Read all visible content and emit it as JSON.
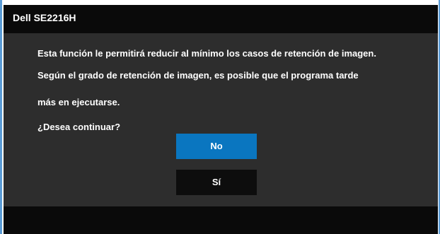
{
  "window": {
    "title": "Dell SE2216H"
  },
  "message": {
    "line1": "Esta función le permitirá reducir al mínimo los casos de retención de imagen.",
    "line2": "Según el grado de retención de imagen, es posible que el programa tarde",
    "line3": "más en ejecutarse.",
    "question": "¿Desea continuar?"
  },
  "buttons": {
    "no_label": "No",
    "si_label": "Sí"
  },
  "colors": {
    "accent": "#0a76c0",
    "panel": "#2d2d2d",
    "bar": "#0a0a0a",
    "border": "#5a9bd6"
  }
}
